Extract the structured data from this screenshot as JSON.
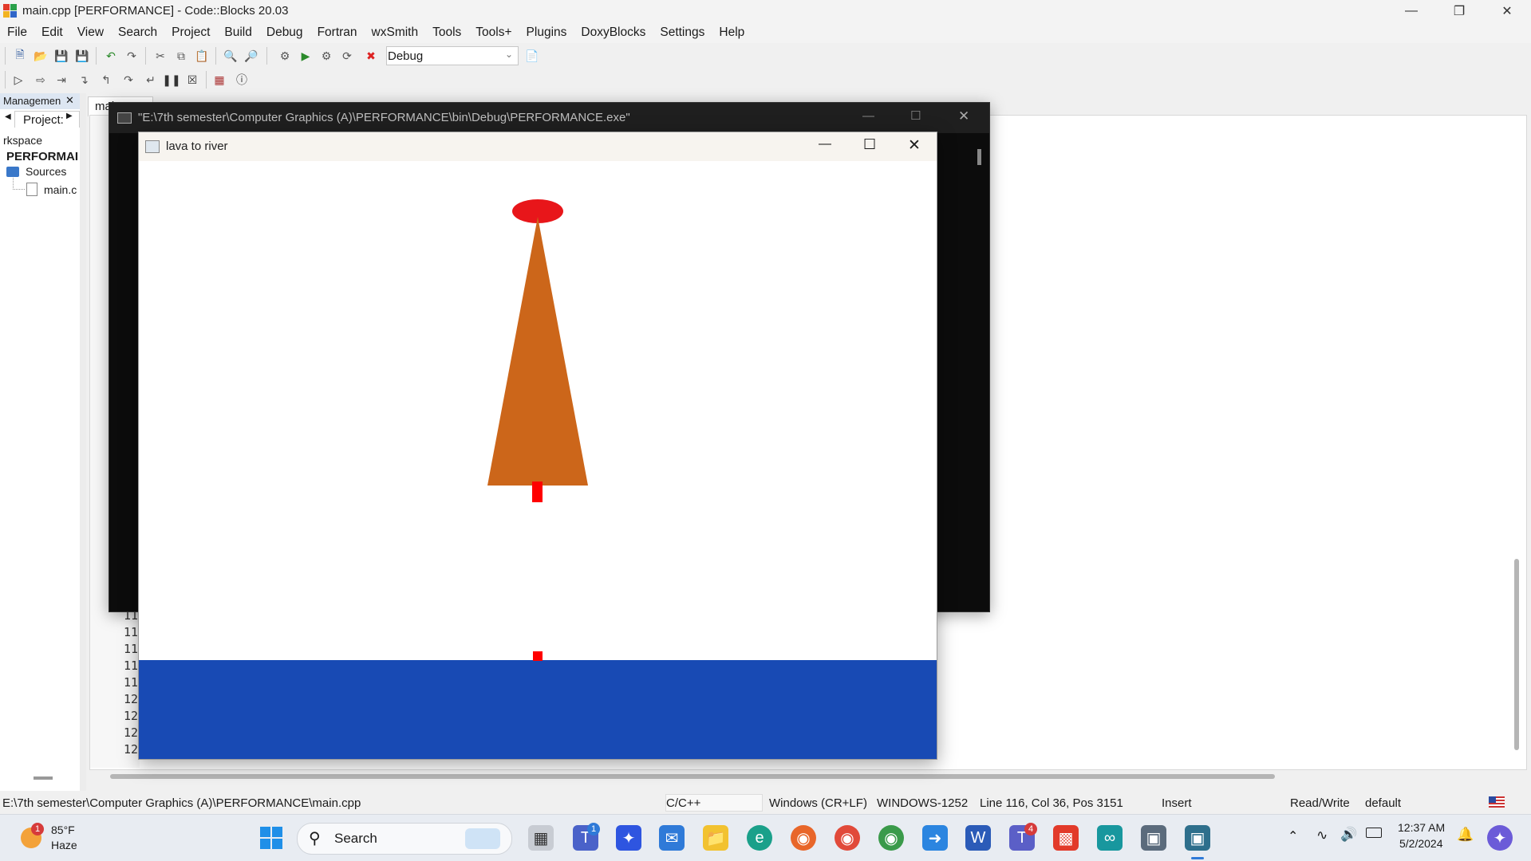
{
  "app": {
    "title": "main.cpp [PERFORMANCE] - Code::Blocks 20.03"
  },
  "menu": [
    "File",
    "Edit",
    "View",
    "Search",
    "Project",
    "Build",
    "Debug",
    "Fortran",
    "wxSmith",
    "Tools",
    "Tools+",
    "Plugins",
    "DoxyBlocks",
    "Settings",
    "Help"
  ],
  "toolbar": {
    "build_target": "Debug"
  },
  "left_panel": {
    "header": "Managemen",
    "tab": "Project:",
    "workspace": "rkspace",
    "project": "PERFORMAI",
    "sources": "Sources",
    "file": "main.c"
  },
  "editor": {
    "tab": "mai",
    "line_numbers": [
      "11",
      "11",
      "11",
      "11",
      "11",
      "12",
      "12",
      "12",
      "12"
    ]
  },
  "console": {
    "title": "\"E:\\7th semester\\Computer Graphics (A)\\PERFORMANCE\\bin\\Debug\\PERFORMANCE.exe\""
  },
  "graphics_window": {
    "title": "lava to river",
    "colors": {
      "lava_top": "#e8161a",
      "volcano": "#cc661a",
      "drop": "#ff0000",
      "river": "#184ab4"
    }
  },
  "status": {
    "path": "E:\\7th semester\\Computer Graphics (A)\\PERFORMANCE\\main.cpp",
    "lang": "C/C++",
    "eol": "Windows (CR+LF)",
    "encoding": "WINDOWS-1252",
    "position": "Line 116, Col 36, Pos 3151",
    "mode": "Insert",
    "access": "Read/Write",
    "profile": "default"
  },
  "taskbar": {
    "weather_temp": "85°F",
    "weather_desc": "Haze",
    "weather_badge": "1",
    "search": "Search",
    "teams_badge": "1",
    "teams2_badge": "4",
    "time": "12:37 AM",
    "date": "5/2/2024"
  }
}
